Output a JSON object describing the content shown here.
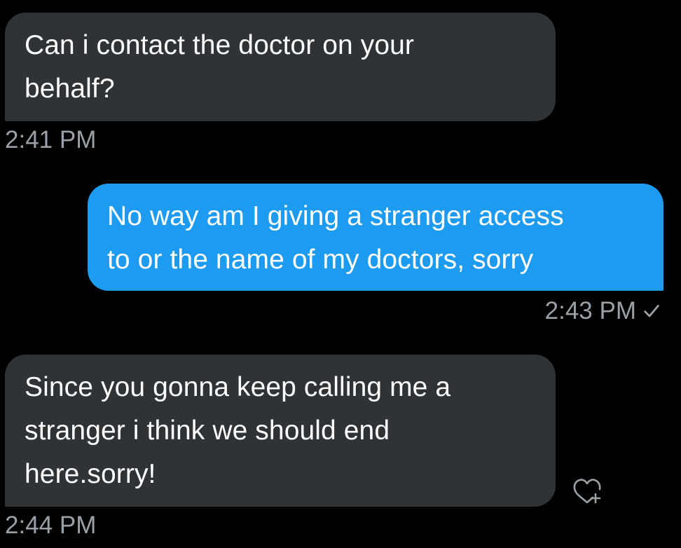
{
  "conversation": {
    "messages": [
      {
        "direction": "received",
        "text": "Can i contact the doctor on your\nbehalf?",
        "time": "2:41 PM"
      },
      {
        "direction": "sent",
        "text": "No way am I giving a stranger access\nto or the name of my doctors, sorry",
        "time": "2:43 PM",
        "status_icon": "check-icon"
      },
      {
        "direction": "received",
        "text": "Since you gonna keep calling me a\nstranger i think we should end\nhere.sorry!",
        "time": "2:44 PM",
        "reaction_icon": "add-reaction-heart-icon"
      }
    ]
  },
  "colors": {
    "background": "#000000",
    "received_bubble": "#2f3336",
    "sent_bubble": "#1d9bf0",
    "timestamp": "#9aa0a6"
  }
}
